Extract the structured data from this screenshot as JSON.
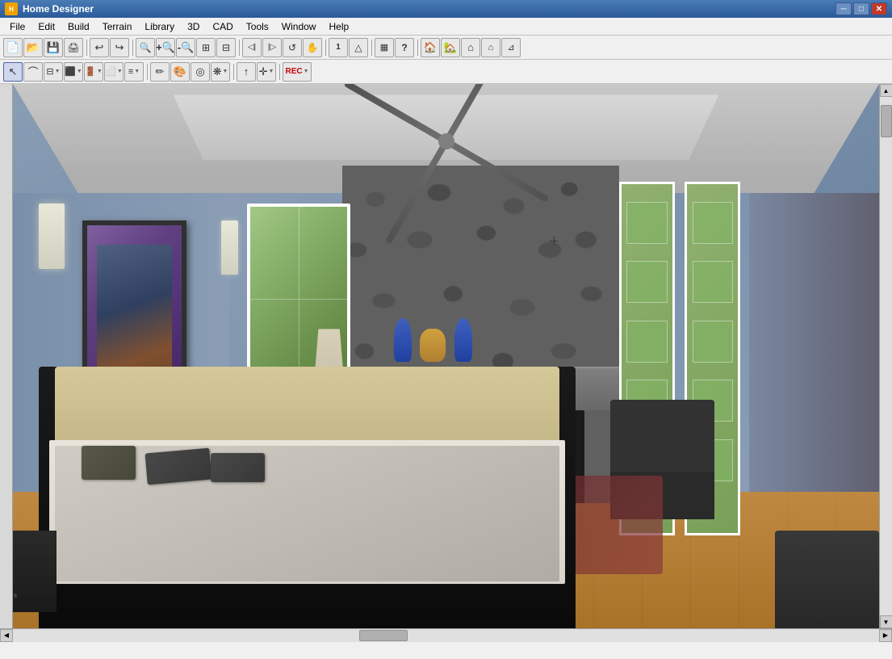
{
  "titlebar": {
    "title": "Home Designer",
    "minimize_label": "─",
    "maximize_label": "□",
    "close_label": "✕"
  },
  "menubar": {
    "items": [
      {
        "id": "file",
        "label": "File"
      },
      {
        "id": "edit",
        "label": "Edit"
      },
      {
        "id": "build",
        "label": "Build"
      },
      {
        "id": "terrain",
        "label": "Terrain"
      },
      {
        "id": "library",
        "label": "Library"
      },
      {
        "id": "3d",
        "label": "3D"
      },
      {
        "id": "cad",
        "label": "CAD"
      },
      {
        "id": "tools",
        "label": "Tools"
      },
      {
        "id": "window",
        "label": "Window"
      },
      {
        "id": "help",
        "label": "Help"
      }
    ]
  },
  "toolbar1": {
    "buttons": [
      {
        "id": "new",
        "icon": "📄",
        "tooltip": "New"
      },
      {
        "id": "open",
        "icon": "📂",
        "tooltip": "Open"
      },
      {
        "id": "save",
        "icon": "💾",
        "tooltip": "Save"
      },
      {
        "id": "print",
        "icon": "🖨",
        "tooltip": "Print"
      },
      {
        "id": "undo",
        "icon": "↩",
        "tooltip": "Undo"
      },
      {
        "id": "redo",
        "icon": "↪",
        "tooltip": "Redo"
      },
      {
        "id": "zoom-out-mag",
        "icon": "🔍",
        "tooltip": "Zoom Out"
      },
      {
        "id": "zoom-in",
        "icon": "⊕",
        "tooltip": "Zoom In"
      },
      {
        "id": "zoom-out",
        "icon": "⊖",
        "tooltip": "Zoom Out"
      },
      {
        "id": "fit-window",
        "icon": "⊞",
        "tooltip": "Fit Window"
      },
      {
        "id": "fit-all",
        "icon": "▣",
        "tooltip": "Fit All"
      },
      {
        "id": "view-1",
        "icon": "◪",
        "tooltip": "View 1"
      },
      {
        "id": "view-2",
        "icon": "◩",
        "tooltip": "View 2"
      },
      {
        "id": "orbit",
        "icon": "↺",
        "tooltip": "Orbit"
      },
      {
        "id": "pan",
        "icon": "✋",
        "tooltip": "Pan"
      },
      {
        "id": "sep1",
        "type": "separator"
      },
      {
        "id": "tools-1",
        "icon": "◈",
        "tooltip": "Tools"
      },
      {
        "id": "help-btn",
        "icon": "?",
        "tooltip": "Help"
      },
      {
        "id": "sep2",
        "type": "separator"
      },
      {
        "id": "house-ext",
        "icon": "🏠",
        "tooltip": "Exterior"
      },
      {
        "id": "house-int",
        "icon": "🏡",
        "tooltip": "Interior"
      },
      {
        "id": "stairs",
        "icon": "▲",
        "tooltip": "Stairs"
      },
      {
        "id": "roof-1",
        "icon": "⌂",
        "tooltip": "Roof 1"
      },
      {
        "id": "roof-2",
        "icon": "⌂",
        "tooltip": "Roof 2"
      }
    ]
  },
  "toolbar2": {
    "buttons": [
      {
        "id": "select",
        "icon": "↖",
        "tooltip": "Select"
      },
      {
        "id": "curve",
        "icon": "⌒",
        "tooltip": "Curve"
      },
      {
        "id": "wall",
        "icon": "⊟",
        "tooltip": "Wall"
      },
      {
        "id": "room",
        "icon": "⬛",
        "tooltip": "Room"
      },
      {
        "id": "door",
        "icon": "🚪",
        "tooltip": "Door"
      },
      {
        "id": "window-btn",
        "icon": "⬜",
        "tooltip": "Window"
      },
      {
        "id": "stair-btn",
        "icon": "≡",
        "tooltip": "Stairs"
      },
      {
        "id": "sep3",
        "type": "separator"
      },
      {
        "id": "paint",
        "icon": "🖊",
        "tooltip": "Paint"
      },
      {
        "id": "material",
        "icon": "🎨",
        "tooltip": "Material"
      },
      {
        "id": "pattern",
        "icon": "◎",
        "tooltip": "Pattern"
      },
      {
        "id": "texture",
        "icon": "❋",
        "tooltip": "Texture"
      },
      {
        "id": "sep4",
        "type": "separator"
      },
      {
        "id": "arrow-up",
        "icon": "↑",
        "tooltip": "Move Up"
      },
      {
        "id": "transform",
        "icon": "⊕",
        "tooltip": "Transform"
      },
      {
        "id": "sep5",
        "type": "separator"
      },
      {
        "id": "rec",
        "icon": "⏺",
        "tooltip": "Record",
        "label": "REC"
      }
    ]
  },
  "statusbar": {
    "text": ""
  },
  "room": {
    "description": "3D bedroom render with fireplace"
  }
}
